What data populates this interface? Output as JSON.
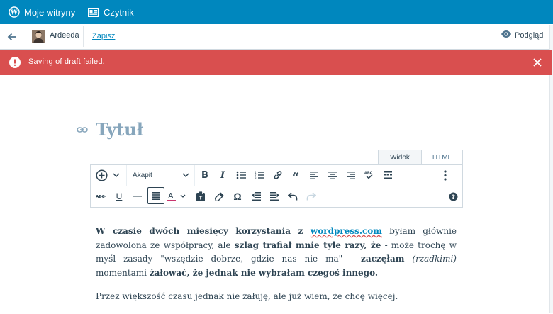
{
  "masterbar": {
    "my_sites_label": "Moje witryny",
    "reader_label": "Czytnik",
    "background": "#0087be"
  },
  "editor_bar": {
    "site_name": "Ardeeda",
    "save_label": "Zapisz",
    "preview_label": "Podgląd"
  },
  "notice": {
    "text": "Saving of draft failed.",
    "color": "#d94f4f",
    "icon": "error-icon"
  },
  "post": {
    "title_placeholder": "Tytuł",
    "tabs": [
      {
        "label": "Widok",
        "active": true
      },
      {
        "label": "HTML",
        "active": false
      }
    ],
    "format_select": "Akapit",
    "paragraph1": {
      "p1": "W czasie dwóch miesięcy korzystania z ",
      "link": "wordpress.com",
      "p2": " byłam głównie zadowolona ze współpracy, ale ",
      "b1": "szlag trafiał mnie tyle razy, że",
      "p3": " - może trochę w myśl zasady \"wszędzie dobrze, gdzie nas nie ma\" - ",
      "b2": "zaczęłam",
      "p4": " ",
      "i1": "(rzadkimi)",
      "p5": " momentami ",
      "b3": "żałować, że jednak nie wybrałam czegoś innego."
    },
    "paragraph2": "Przez większość czasu jednak nie żałuję, ale już wiem, że chcę więcej."
  },
  "toolbar_icons": {
    "row1": [
      "add-block-icon",
      "chevron-down-icon",
      "bold-icon",
      "italic-icon",
      "bullet-list-icon",
      "numbered-list-icon",
      "link-icon",
      "blockquote-icon",
      "align-left-icon",
      "align-center-icon",
      "align-right-icon",
      "spellcheck-icon",
      "read-more-icon",
      "more-options-icon"
    ],
    "row2": [
      "strikethrough-icon",
      "underline-icon",
      "horizontal-line-icon",
      "justify-icon",
      "text-color-icon",
      "paste-text-icon",
      "clear-formatting-icon",
      "special-character-icon",
      "outdent-icon",
      "indent-icon",
      "undo-icon",
      "redo-icon",
      "help-icon"
    ]
  }
}
